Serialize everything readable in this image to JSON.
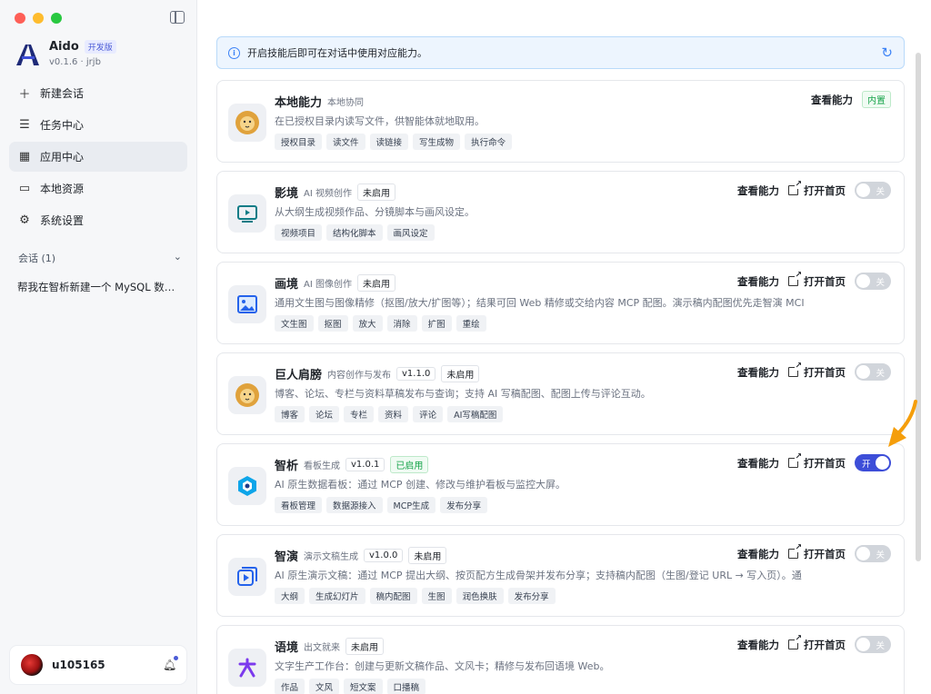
{
  "sidebar": {
    "brand": {
      "name": "Aido",
      "tag": "开发版",
      "sub": "v0.1.6 · jrjb"
    },
    "nav": [
      {
        "label": "新建会话",
        "icon": "plus-icon"
      },
      {
        "label": "任务中心",
        "icon": "list-icon"
      },
      {
        "label": "应用中心",
        "icon": "grid-icon"
      },
      {
        "label": "本地资源",
        "icon": "folder-icon"
      },
      {
        "label": "系统设置",
        "icon": "gear-icon"
      }
    ],
    "sessions_label": "会话 (1)",
    "session_item": "帮我在智析新建一个 MySQL 数据源",
    "user": "u105165"
  },
  "banner": {
    "text": "开启技能后即可在对话中使用对应能力。"
  },
  "labels": {
    "view": "查看能力",
    "open": "打开首页",
    "on": "开",
    "off": "关"
  },
  "cards": [
    {
      "title": "本地能力",
      "sub": "本地协同",
      "badge": "内置",
      "desc": "在已授权目录内读写文件，供智能体就地取用。",
      "chips": [
        "授权目录",
        "读文件",
        "读链接",
        "写生成物",
        "执行命令"
      ]
    },
    {
      "title": "影境",
      "sub": "AI 视频创作",
      "status": "未启用",
      "desc": "从大纲生成视频作品、分镜脚本与画风设定。",
      "chips": [
        "视频项目",
        "结构化脚本",
        "画风设定"
      ]
    },
    {
      "title": "画境",
      "sub": "AI 图像创作",
      "status": "未启用",
      "desc": "通用文生图与图像精修（抠图/放大/扩图等）；结果可回 Web 精修或交给内容 MCP 配图。演示稿内配图优先走智演 MCI",
      "chips": [
        "文生图",
        "抠图",
        "放大",
        "消除",
        "扩图",
        "重绘"
      ]
    },
    {
      "title": "巨人肩膀",
      "sub": "内容创作与发布",
      "version": "v1.1.0",
      "status": "未启用",
      "desc": "博客、论坛、专栏与资料草稿发布与查询；支持 AI 写稿配图、配图上传与评论互动。",
      "chips": [
        "博客",
        "论坛",
        "专栏",
        "资料",
        "评论",
        "AI写稿配图"
      ]
    },
    {
      "title": "智析",
      "sub": "看板生成",
      "version": "v1.0.1",
      "status": "已启用",
      "desc": "AI 原生数据看板：通过 MCP 创建、修改与维护看板与监控大屏。",
      "chips": [
        "看板管理",
        "数据源接入",
        "MCP生成",
        "发布分享"
      ]
    },
    {
      "title": "智演",
      "sub": "演示文稿生成",
      "version": "v1.0.0",
      "status": "未启用",
      "desc": "AI 原生演示文稿：通过 MCP 提出大纲、按页配方生成骨架并发布分享；支持稿内配图（生图/登记 URL → 写入页）。通",
      "chips": [
        "大纲",
        "生成幻灯片",
        "稿内配图",
        "生图",
        "润色换肤",
        "发布分享"
      ]
    },
    {
      "title": "语境",
      "sub": "出文就来",
      "status": "未启用",
      "desc": "文字生产工作台：创建与更新文稿作品、文风卡；精修与发布回语境 Web。",
      "chips": [
        "作品",
        "文风",
        "短文案",
        "口播稿"
      ]
    }
  ]
}
